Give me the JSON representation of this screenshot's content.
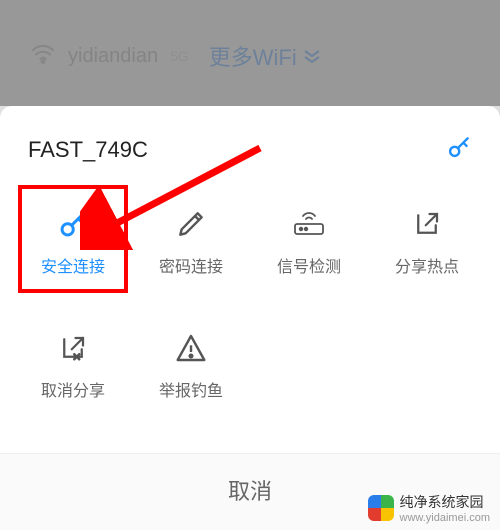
{
  "colors": {
    "accent": "#1e90ff",
    "highlight": "#ff0000",
    "text": "#666"
  },
  "background": {
    "ssid": "yidiandian",
    "band": "5G",
    "more_wifi_label": "更多WiFi"
  },
  "sheet": {
    "network_name": "FAST_749C",
    "key_icon": "key-icon"
  },
  "grid": {
    "items": [
      {
        "name": "secure-connect",
        "label": "安全连接",
        "icon": "key-icon",
        "active": true,
        "highlighted": true
      },
      {
        "name": "password-connect",
        "label": "密码连接",
        "icon": "pencil-icon",
        "active": false
      },
      {
        "name": "signal-check",
        "label": "信号检测",
        "icon": "router-icon",
        "active": false
      },
      {
        "name": "share-hotspot",
        "label": "分享热点",
        "icon": "share-icon",
        "active": false
      },
      {
        "name": "cancel-share",
        "label": "取消分享",
        "icon": "share-cancel-icon",
        "active": false
      },
      {
        "name": "report-phishing",
        "label": "举报钓鱼",
        "icon": "warning-icon",
        "active": false
      }
    ]
  },
  "cancel_label": "取消",
  "watermark": {
    "brand": "纯净系统家园",
    "url": "www.yidaimei.com"
  },
  "annotation": {
    "arrow": "arrow-pointing-to-secure-connect"
  }
}
